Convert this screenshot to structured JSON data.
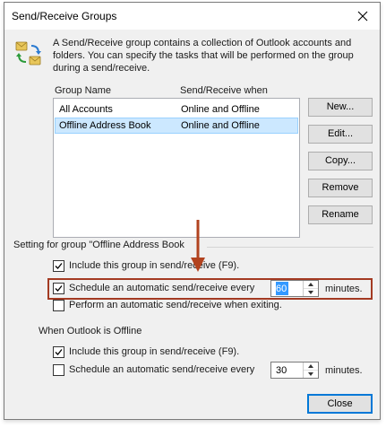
{
  "dialog": {
    "title": "Send/Receive Groups",
    "description": "A Send/Receive group contains a collection of Outlook accounts and folders. You can specify the tasks that will be performed on the group during a send/receive."
  },
  "list": {
    "columns": [
      "Group Name",
      "Send/Receive when"
    ],
    "rows": [
      {
        "name": "All Accounts",
        "when": "Online and Offline",
        "selected": false
      },
      {
        "name": "Offline Address Book",
        "when": "Online and Offline",
        "selected": true
      }
    ]
  },
  "buttons": {
    "new": "New...",
    "edit": "Edit...",
    "copy": "Copy...",
    "remove": "Remove",
    "rename": "Rename",
    "close": "Close"
  },
  "group_settings": {
    "label": "Setting for group \"Offline Address Book",
    "online": {
      "include": {
        "label": "Include this group in send/receive (F9).",
        "checked": true
      },
      "schedule": {
        "label": "Schedule an automatic send/receive every",
        "checked": true,
        "value": "60",
        "unit": "minutes."
      },
      "on_exit": {
        "label": "Perform an automatic send/receive when exiting.",
        "checked": false
      }
    },
    "offline_heading": "When Outlook is Offline",
    "offline": {
      "include": {
        "label": "Include this group in send/receive (F9).",
        "checked": true
      },
      "schedule": {
        "label": "Schedule an automatic send/receive every",
        "checked": false,
        "value": "30",
        "unit": "minutes."
      }
    }
  },
  "colors": {
    "selection": "#cce8ff",
    "highlight_border": "#a33a22",
    "arrow": "#b2431f",
    "default_button_border": "#0078d7"
  },
  "icons": {
    "dialog_icon": "send-receive-icon",
    "close": "close-icon",
    "annotation": "arrow-down-icon"
  }
}
